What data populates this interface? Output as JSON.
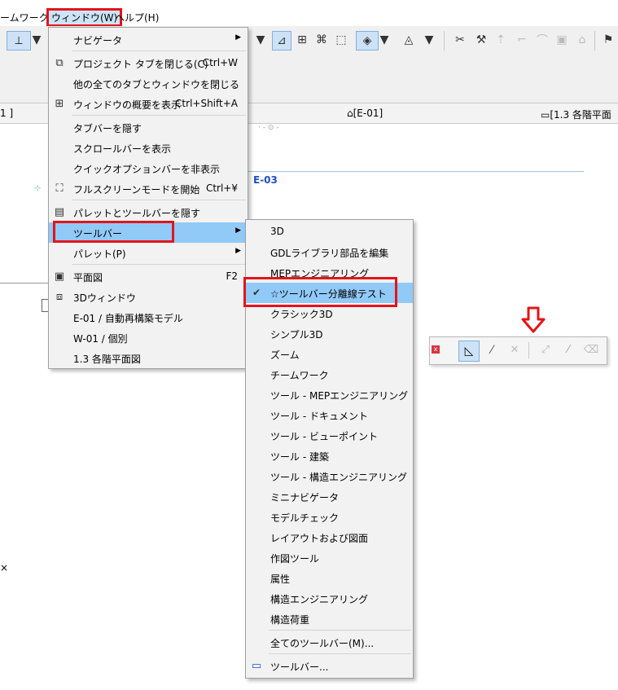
{
  "menubar": {
    "items": [
      {
        "label": "ームワーク(T)"
      },
      {
        "label": "ウィンドウ(W)"
      },
      {
        "label": "ヘルプ(H)"
      }
    ]
  },
  "toolbar": {
    "left_icon": "dimension-icon",
    "icons": [
      "adjust-icon",
      "ruler-icon",
      "snap-icon",
      "select-icon",
      "shape-icon",
      "circle-icon",
      "trim-icon",
      "pick-icon",
      "elevate-icon",
      "corner-icon",
      "curve-icon",
      "group-icon",
      "house-icon",
      "flag-icon"
    ]
  },
  "tabs": {
    "left": "1 ]",
    "middle": "[E-01]",
    "right": "[1.3 各階平面"
  },
  "canvas": {
    "label_e03": "E-03"
  },
  "window_menu": {
    "items": [
      {
        "label": "ナビゲータ",
        "shortcut": "",
        "submenu": true
      },
      {
        "label": "プロジェクト タブを閉じる(C)",
        "shortcut": "Ctrl+W",
        "icon": "close-tab-icon"
      },
      {
        "label": "他の全てのタブとウィンドウを閉じる",
        "shortcut": ""
      },
      {
        "label": "ウィンドウの概要を表示",
        "shortcut": "Ctrl+Shift+A",
        "icon": "grid-icon"
      },
      {
        "label": "タブバーを隠す",
        "shortcut": ""
      },
      {
        "label": "スクロールバーを表示",
        "shortcut": ""
      },
      {
        "label": "クイックオプションバーを非表示",
        "shortcut": ""
      },
      {
        "label": "フルスクリーンモードを開始",
        "shortcut": "Ctrl+¥",
        "icon": "fullscreen-icon"
      },
      {
        "label": "パレットとツールバーを隠す",
        "shortcut": "",
        "icon": "palette-icon"
      },
      {
        "label": "ツールバー",
        "shortcut": "",
        "submenu": true
      },
      {
        "label": "パレット(P)",
        "shortcut": "",
        "submenu": true
      },
      {
        "label": "平面図",
        "shortcut": "F2",
        "icon": "floorplan-icon"
      },
      {
        "label": "3Dウィンドウ",
        "shortcut": "",
        "icon": "cube-icon"
      },
      {
        "label": "E-01 / 自動再構築モデル",
        "shortcut": ""
      },
      {
        "label": "W-01 / 個別",
        "shortcut": ""
      },
      {
        "label": "1.3 各階平面図",
        "shortcut": ""
      }
    ]
  },
  "toolbar_submenu": {
    "items": [
      {
        "label": "3D"
      },
      {
        "label": "GDLライブラリ部品を編集"
      },
      {
        "label": "MEPエンジニアリング"
      },
      {
        "label": "☆ツールバー分離線テスト",
        "checked": true
      },
      {
        "label": "クラシック3D"
      },
      {
        "label": "シンプル3D"
      },
      {
        "label": "ズーム"
      },
      {
        "label": "チームワーク"
      },
      {
        "label": "ツール - MEPエンジニアリング"
      },
      {
        "label": "ツール - ドキュメント"
      },
      {
        "label": "ツール - ビューポイント"
      },
      {
        "label": "ツール - 建築"
      },
      {
        "label": "ツール - 構造エンジニアリング"
      },
      {
        "label": "ミニナビゲータ"
      },
      {
        "label": "モデルチェック"
      },
      {
        "label": "レイアウトおよび図面"
      },
      {
        "label": "作図ツール"
      },
      {
        "label": "属性"
      },
      {
        "label": "構造エンジニアリング"
      },
      {
        "label": "構造荷重"
      },
      {
        "label": "全てのツールバー(M)..."
      },
      {
        "label": "ツールバー..."
      }
    ]
  },
  "floating_toolbar": {
    "close_label": "x",
    "icons": [
      "triangle-ruler-icon",
      "line-icon",
      "cross-icon",
      "diagonal-icon",
      "measure-icon",
      "eraser-icon"
    ]
  },
  "colors": {
    "highlight": "#91c9f7",
    "annotation_red": "#e3141b",
    "accent_blue": "#1f4fc7"
  }
}
